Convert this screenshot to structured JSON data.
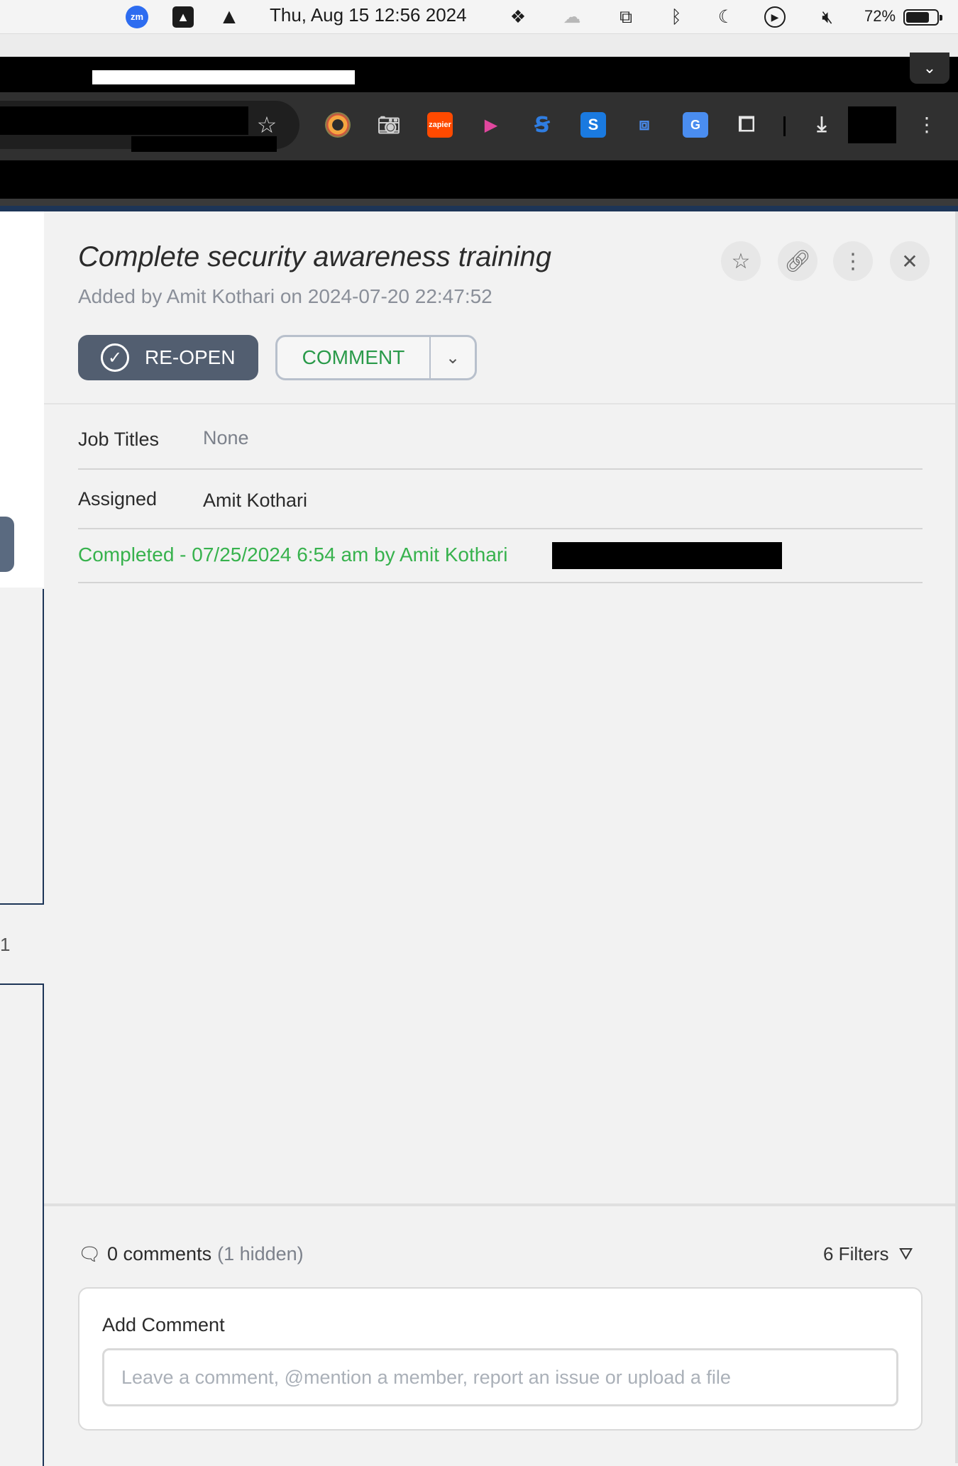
{
  "menubar": {
    "clock": "Thu, Aug 15  12:56 2024",
    "battery_pct": "72%",
    "icons": [
      "zoom-icon",
      "drive-icon",
      "vlc-icon",
      "dropbox-icon",
      "cloud-icon",
      "screens-icon",
      "bluetooth-icon",
      "moon-icon",
      "play-icon",
      "mute-icon",
      "battery-icon"
    ]
  },
  "browser": {
    "extensions": [
      "eye-extension-icon",
      "camera-extension-icon",
      "zapier-extension-icon",
      "video-extension-icon",
      "sync-extension-icon",
      "s-extension-icon",
      "translate-box-extension-icon",
      "google-translate-extension-icon",
      "puzzle-extensions-icon"
    ],
    "zapier_label": "zapier"
  },
  "task": {
    "title": "Complete security awareness training",
    "meta": "Added by Amit Kothari on 2024-07-20 22:47:52",
    "reopen_label": "RE-OPEN",
    "comment_label": "COMMENT"
  },
  "fields": {
    "job_titles_label": "Job Titles",
    "job_titles_value": "None",
    "assigned_label": "Assigned",
    "assigned_value": "Amit Kothari",
    "completed_text": "Completed - 07/25/2024 6:54 am by Amit Kothari"
  },
  "comments": {
    "count_text": "0 comments",
    "hidden_text": "(1 hidden)",
    "filters_text": "6 Filters",
    "add_heading": "Add Comment",
    "placeholder": "Leave a comment, @mention a member, report an issue or upload a file"
  },
  "leftpage": {
    "number": "1"
  },
  "colors": {
    "accent_green": "#37b24d",
    "button_slate": "#525e70",
    "comment_green": "#2a9a4a"
  }
}
